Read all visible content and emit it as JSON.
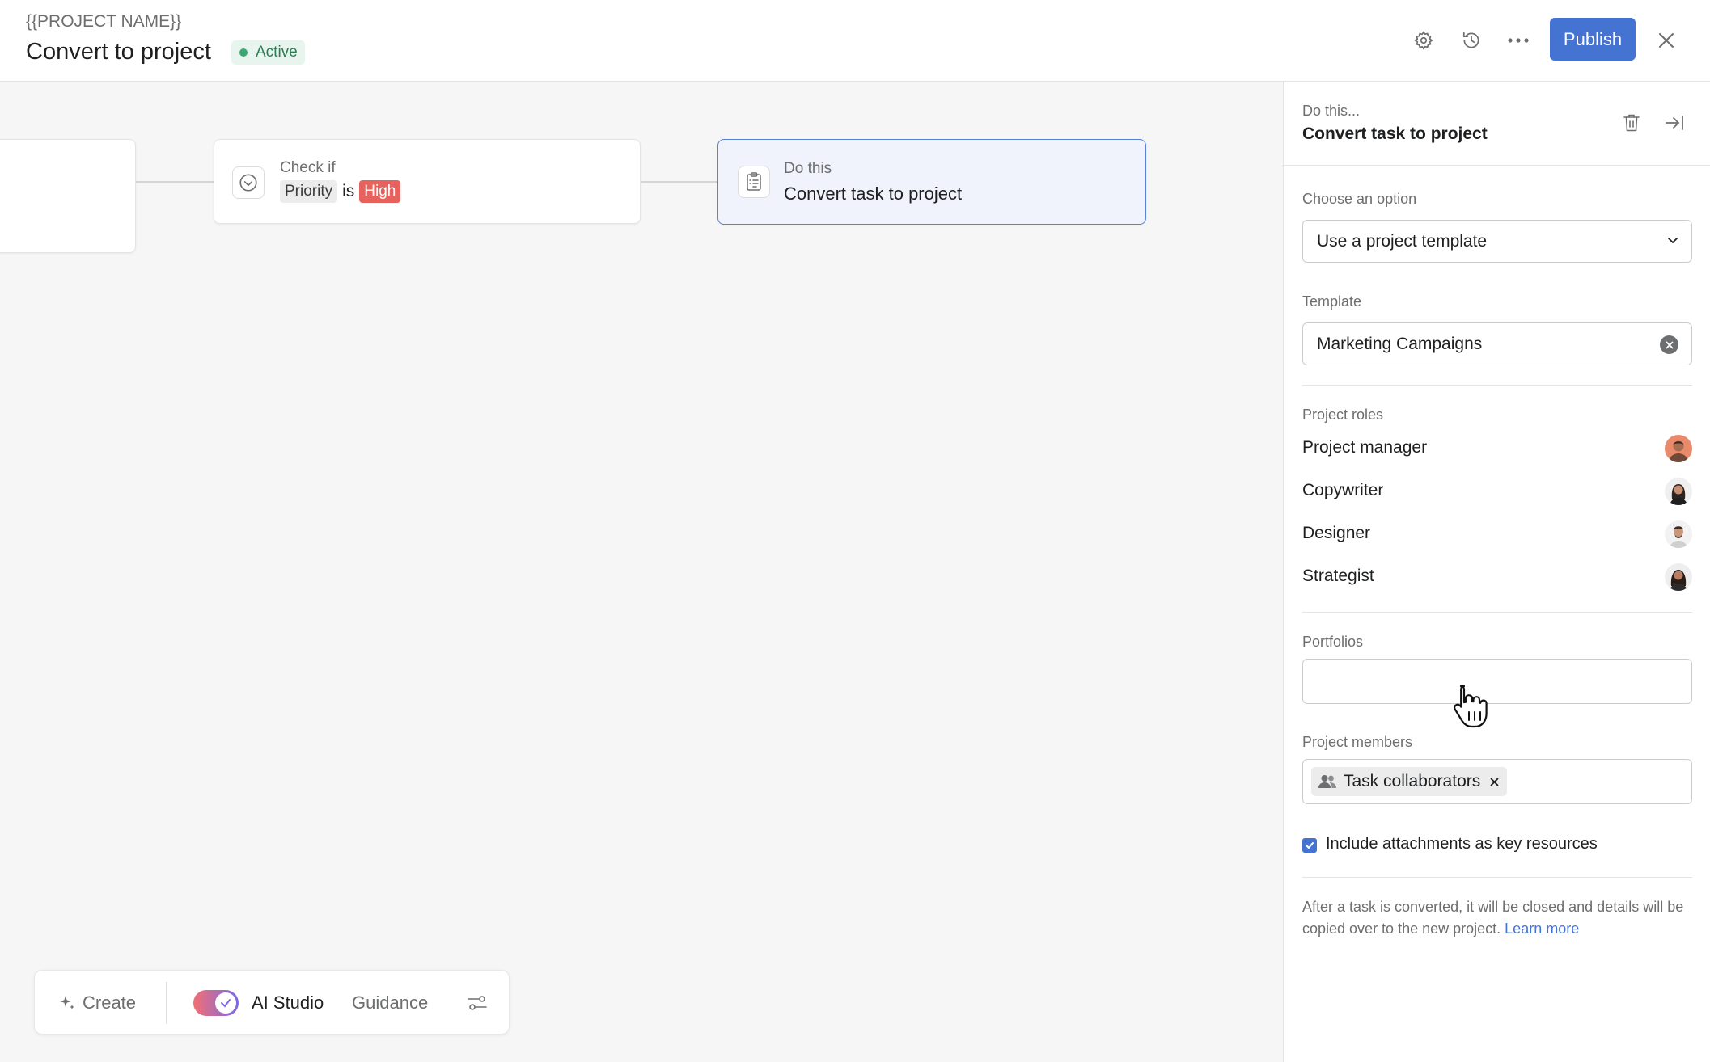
{
  "header": {
    "project_name": "{{PROJECT NAME}}",
    "title": "Convert to project",
    "status": "Active",
    "publish_label": "Publish",
    "icons": [
      "gear-icon",
      "history-icon",
      "more-icon",
      "close-icon"
    ]
  },
  "canvas": {
    "check_node": {
      "label": "Check if",
      "field": "Priority",
      "operator": "is",
      "value": "High"
    },
    "action_node": {
      "label": "Do this",
      "action": "Convert task to project"
    }
  },
  "toolbar": {
    "create_label": "Create",
    "ai_studio_label": "AI Studio",
    "ai_studio_enabled": true,
    "guidance_label": "Guidance"
  },
  "panel": {
    "header_label": "Do this...",
    "header_title": "Convert task to project",
    "choose_label": "Choose an option",
    "choose_value": "Use a project template",
    "template_label": "Template",
    "template_value": "Marketing Campaigns",
    "roles_label": "Project roles",
    "roles": [
      {
        "name": "Project manager"
      },
      {
        "name": "Copywriter"
      },
      {
        "name": "Designer"
      },
      {
        "name": "Strategist"
      }
    ],
    "portfolios_label": "Portfolios",
    "portfolios_value": "",
    "members_label": "Project members",
    "member_chip": "Task collaborators",
    "include_attachments_label": "Include attachments as key resources",
    "include_attachments_checked": true,
    "footnote": "After a task is converted, it will be closed and details will be copied over to the new project.",
    "learn_more": "Learn more"
  },
  "colors": {
    "accent": "#4573d2",
    "active_green": "#2b7c53",
    "high_red": "#e8625d"
  }
}
